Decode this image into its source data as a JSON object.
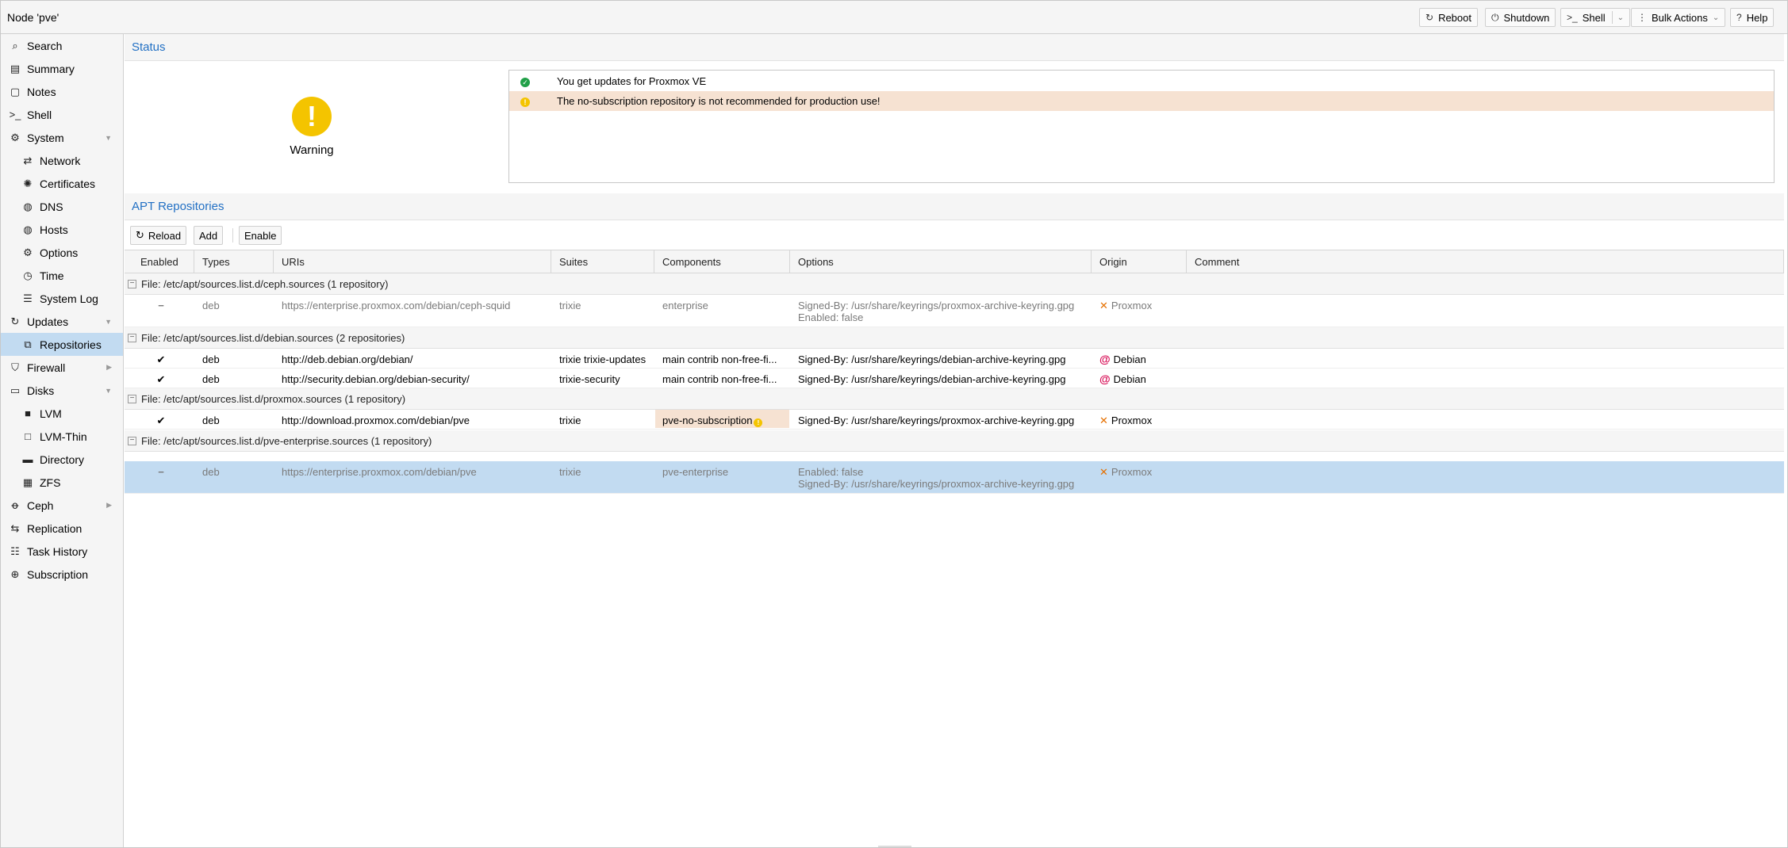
{
  "header": {
    "title": "Node 'pve'",
    "buttons": {
      "reboot": "Reboot",
      "shutdown": "Shutdown",
      "shell": "Shell",
      "bulk": "Bulk Actions",
      "help": "Help"
    }
  },
  "sidebar": {
    "items": [
      {
        "label": "Search"
      },
      {
        "label": "Summary"
      },
      {
        "label": "Notes"
      },
      {
        "label": "Shell"
      },
      {
        "label": "System"
      },
      {
        "label": "Network"
      },
      {
        "label": "Certificates"
      },
      {
        "label": "DNS"
      },
      {
        "label": "Hosts"
      },
      {
        "label": "Options"
      },
      {
        "label": "Time"
      },
      {
        "label": "System Log"
      },
      {
        "label": "Updates"
      },
      {
        "label": "Repositories"
      },
      {
        "label": "Firewall"
      },
      {
        "label": "Disks"
      },
      {
        "label": "LVM"
      },
      {
        "label": "LVM-Thin"
      },
      {
        "label": "Directory"
      },
      {
        "label": "ZFS"
      },
      {
        "label": "Ceph"
      },
      {
        "label": "Replication"
      },
      {
        "label": "Task History"
      },
      {
        "label": "Subscription"
      }
    ],
    "selected": "Repositories"
  },
  "status": {
    "title": "Status",
    "state": "Warning",
    "messages": [
      "You get updates for Proxmox VE",
      "The no-subscription repository is not recommended for production use!"
    ]
  },
  "repos": {
    "title": "APT Repositories",
    "toolbar": {
      "reload": "Reload",
      "add": "Add",
      "enable": "Enable"
    },
    "columns": [
      "Enabled",
      "Types",
      "URIs",
      "Suites",
      "Components",
      "Options",
      "Origin",
      "Comment"
    ],
    "groups": [
      {
        "label": "File: /etc/apt/sources.list.d/ceph.sources (1 repository)",
        "rows": [
          {
            "enabled": "−",
            "types": "deb",
            "uri": "https://enterprise.proxmox.com/debian/ceph-squid",
            "suites": "trixie",
            "components": "enterprise",
            "options1": "Signed-By: /usr/share/keyrings/proxmox-archive-keyring.gpg",
            "options2": "Enabled: false",
            "origin": "Proxmox"
          }
        ]
      },
      {
        "label": "File: /etc/apt/sources.list.d/debian.sources (2 repositories)",
        "rows": [
          {
            "enabled": "✔",
            "types": "deb",
            "uri": "http://deb.debian.org/debian/",
            "suites": "trixie trixie-updates",
            "components": "main contrib non-free-fi...",
            "options1": "Signed-By: /usr/share/keyrings/debian-archive-keyring.gpg",
            "origin": "Debian"
          },
          {
            "enabled": "✔",
            "types": "deb",
            "uri": "http://security.debian.org/debian-security/",
            "suites": "trixie-security",
            "components": "main contrib non-free-fi...",
            "options1": "Signed-By: /usr/share/keyrings/debian-archive-keyring.gpg",
            "origin": "Debian"
          }
        ]
      },
      {
        "label": "File: /etc/apt/sources.list.d/proxmox.sources (1 repository)",
        "rows": [
          {
            "enabled": "✔",
            "types": "deb",
            "uri": "http://download.proxmox.com/debian/pve",
            "suites": "trixie",
            "components": "pve-no-subscription",
            "options1": "Signed-By: /usr/share/keyrings/proxmox-archive-keyring.gpg",
            "origin": "Proxmox"
          }
        ]
      },
      {
        "label": "File: /etc/apt/sources.list.d/pve-enterprise.sources (1 repository)",
        "rows": [
          {
            "enabled": "−",
            "types": "deb",
            "uri": "https://enterprise.proxmox.com/debian/pve",
            "suites": "trixie",
            "components": "pve-enterprise",
            "options1": "Enabled: false",
            "options2": "Signed-By: /usr/share/keyrings/proxmox-archive-keyring.gpg",
            "origin": "Proxmox"
          }
        ]
      }
    ]
  },
  "colors": {
    "accent": "#2270c4",
    "selected": "#c2dbf1",
    "warning": "#f4c400",
    "warning_row": "#f6e2d2",
    "ok": "#21a048"
  }
}
